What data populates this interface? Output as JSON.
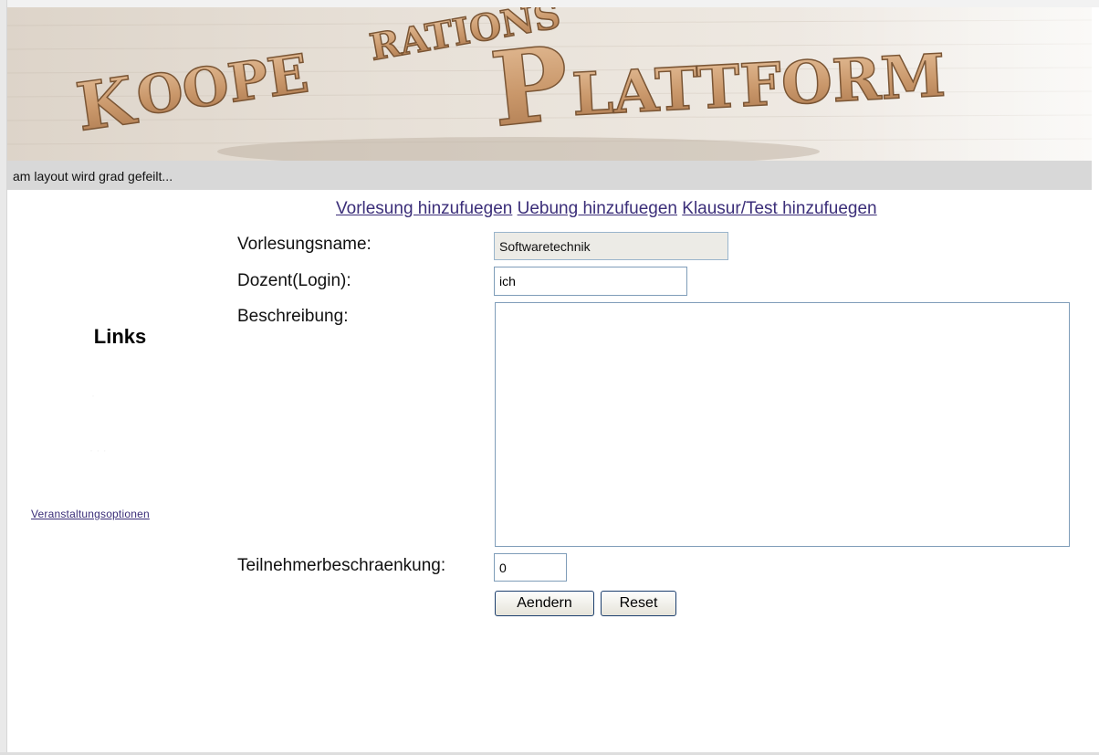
{
  "banner": {
    "logo_text": "KOOPERATIONSPLATTFORM"
  },
  "status_bar": {
    "text": "am layout wird grad gefeilt..."
  },
  "sidebar": {
    "heading": "Links",
    "link": "Veranstaltungsoptionen"
  },
  "topnav": {
    "items": [
      {
        "label": "Vorlesung hinzufuegen"
      },
      {
        "label": "Uebung hinzufuegen"
      },
      {
        "label": "Klausur/Test hinzufuegen"
      }
    ]
  },
  "form": {
    "name_label": "Vorlesungsname:",
    "name_value": "Softwaretechnik",
    "dozent_label": "Dozent(Login):",
    "dozent_value": "ich",
    "description_label": "Beschreibung:",
    "description_value": "",
    "limit_label": "Teilnehmerbeschraenkung:",
    "limit_value": "0",
    "submit_label": "Aendern",
    "reset_label": "Reset"
  },
  "colors": {
    "link": "#3b2e79",
    "status_bar_bg": "#d8d8d8",
    "logo_letters": "#c89a6c"
  }
}
